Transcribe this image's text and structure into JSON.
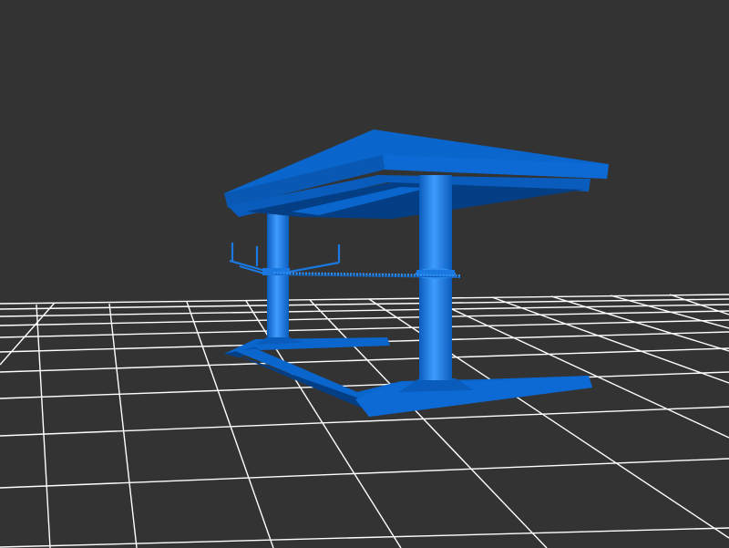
{
  "viewport": {
    "background_color": "#333333",
    "grid_color": "#ffffff",
    "model_color": "#0a66cc",
    "model_highlight_color": "#2f8ff0",
    "model_shadow_color": "#043f86"
  }
}
